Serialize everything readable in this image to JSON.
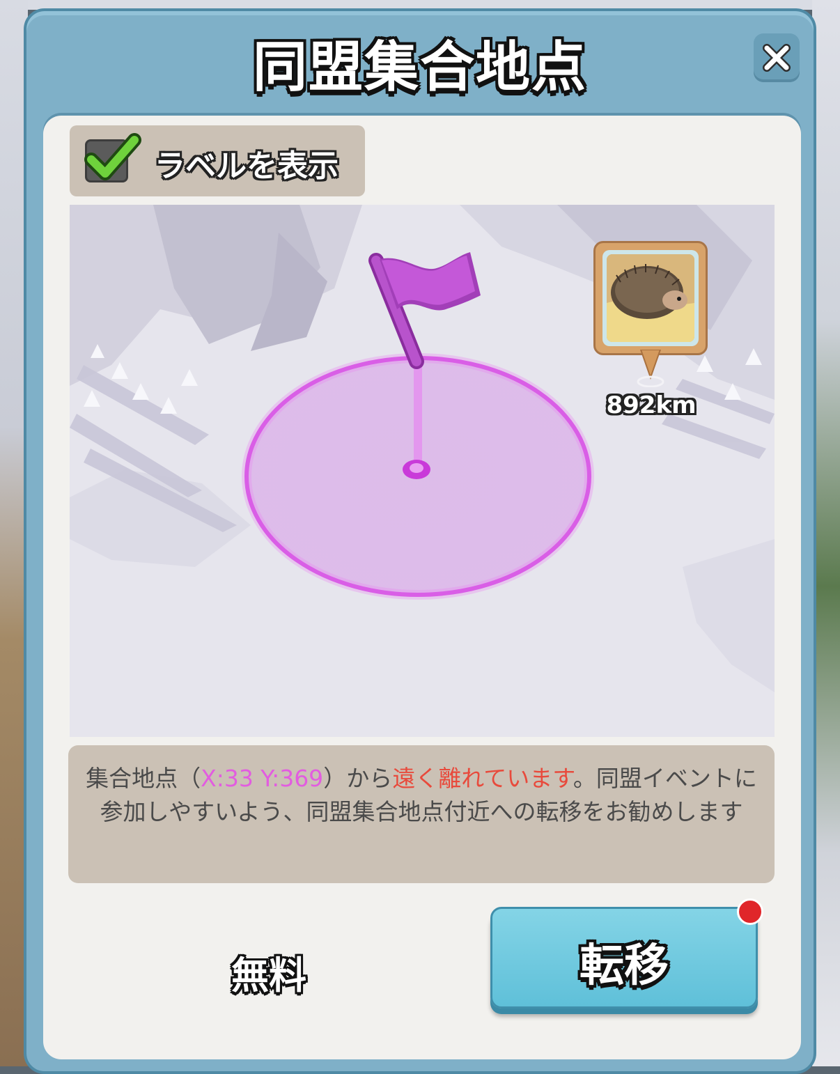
{
  "dialog": {
    "title": "同盟集合地点",
    "close_icon": "close-icon"
  },
  "label_toggle": {
    "checked": true,
    "text": "ラベルを表示"
  },
  "map": {
    "rally_point_icon": "flag-icon",
    "flag_color": "#c24fd6",
    "player_distance": "892km"
  },
  "message": {
    "part1": "集合地点（",
    "coords": "X:33 Y:369",
    "part2": "）から",
    "warning": "遠く離れています",
    "part3": "。同盟イベントに参加しやすいよう、同盟集合地点付近への転移をお勧めします"
  },
  "actions": {
    "cost_label": "無料",
    "teleport_label": "転移",
    "notification": true
  },
  "colors": {
    "coord_highlight": "#e25ce0",
    "warning_text": "#e84a3c",
    "button_primary": "#6cc8de",
    "notification_dot": "#e0262a"
  }
}
